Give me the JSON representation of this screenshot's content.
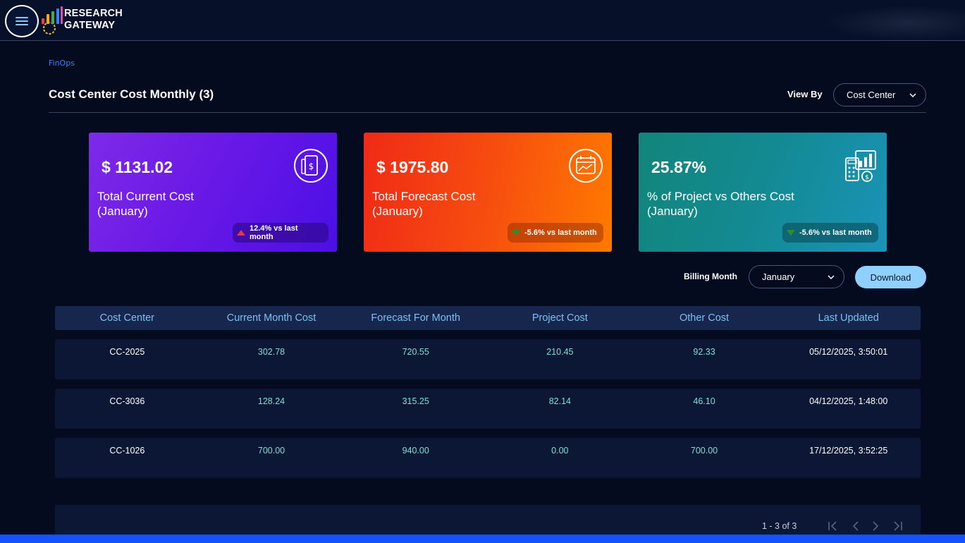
{
  "header": {
    "brand_line1": "RESEARCH",
    "brand_line2": "GATEWAY"
  },
  "breadcrumb": "FinOps",
  "page": {
    "title": "Cost Center Cost Monthly (3)",
    "view_by_label": "View By",
    "view_by_value": "Cost Center"
  },
  "cards": [
    {
      "value": "$ 1131.02",
      "label_line1": "Total Current Cost",
      "label_line2": "(January)",
      "trend": "12.4% vs last month",
      "trend_direction": "up",
      "icon": "receipt-dollar-icon"
    },
    {
      "value": "$ 1975.80",
      "label_line1": "Total Forecast Cost",
      "label_line2": "(January)",
      "trend": "-5.6% vs last month",
      "trend_direction": "down",
      "icon": "calendar-chart-icon"
    },
    {
      "value": "25.87%",
      "label_line1": "% of Project vs Others Cost",
      "label_line2": "(January)",
      "trend": "-5.6% vs last month",
      "trend_direction": "down",
      "icon": "calculator-coins-chart-icon"
    }
  ],
  "billing": {
    "label": "Billing Month",
    "value": "January",
    "download_label": "Download"
  },
  "table": {
    "columns": [
      "Cost Center",
      "Current Month Cost",
      "Forecast For Month",
      "Project Cost",
      "Other Cost",
      "Last Updated"
    ],
    "rows": [
      [
        "CC-2025",
        "302.78",
        "720.55",
        "210.45",
        "92.33",
        "05/12/2025, 3:50:01"
      ],
      [
        "CC-3036",
        "128.24",
        "315.25",
        "82.14",
        "46.10",
        "04/12/2025, 1:48:00"
      ],
      [
        "CC-1026",
        "700.00",
        "940.00",
        "0.00",
        "700.00",
        "17/12/2025, 3:52:25"
      ]
    ]
  },
  "pagination": {
    "range": "1 - 3 of 3"
  },
  "colors": {
    "background": "#050b1f",
    "accent_light_blue": "#8fd0ff",
    "table_value": "#7fe0d2",
    "trend_up": "#e6354a",
    "trend_down": "#2c8f2c"
  }
}
